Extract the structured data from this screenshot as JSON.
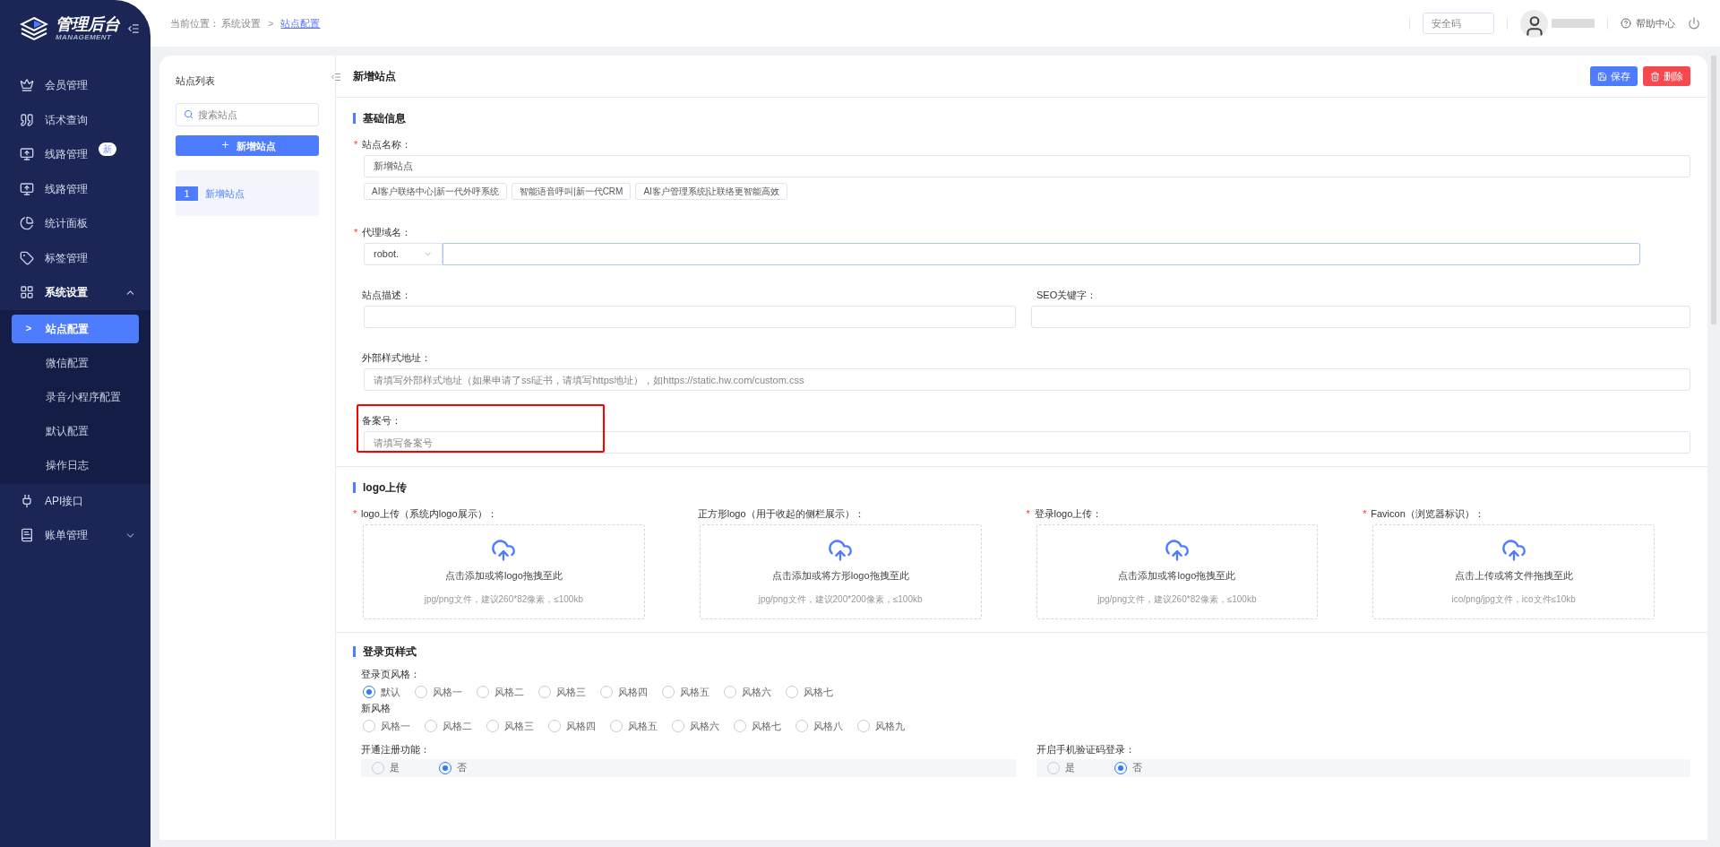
{
  "brand": {
    "title": "管理后台",
    "subtitle": "MANAGEMENT"
  },
  "sidebar": {
    "items": [
      {
        "kind": "link",
        "label": "会员管理",
        "selected": false
      },
      {
        "kind": "link",
        "label": "话术查询",
        "selected": false
      },
      {
        "kind": "link",
        "label": "线路管理",
        "badge": "新",
        "selected": false
      },
      {
        "kind": "link",
        "label": "线路管理",
        "selected": false
      },
      {
        "kind": "link",
        "label": "统计面板",
        "selected": false
      },
      {
        "kind": "link",
        "label": "标签管理",
        "selected": false
      },
      {
        "kind": "group",
        "label": "系统设置",
        "expanded": true,
        "selected": false,
        "children": [
          {
            "label": "站点配置",
            "marker": ">",
            "selected": true
          },
          {
            "label": "微信配置",
            "selected": false
          },
          {
            "label": "录音小程序配置",
            "selected": false
          },
          {
            "label": "默认配置",
            "selected": false
          },
          {
            "label": "操作日志",
            "selected": false
          }
        ]
      },
      {
        "kind": "link",
        "label": "API接口",
        "selected": false
      },
      {
        "kind": "group",
        "label": "账单管理",
        "expanded": false,
        "selected": false
      }
    ]
  },
  "breadcrumb": {
    "prefix": "当前位置：",
    "items": [
      "系统设置",
      "站点配置"
    ],
    "separator": ">"
  },
  "header": {
    "security_code": {
      "placeholder": "安全码"
    },
    "help": "帮助中心"
  },
  "site_list": {
    "title": "站点列表",
    "search": {
      "placeholder": "搜索站点"
    },
    "add_button": "新增站点",
    "items": [
      {
        "index": "1",
        "label": "新增站点",
        "selected": true
      }
    ]
  },
  "form": {
    "title": "新增站点",
    "required_mark": "*",
    "save": "保存",
    "delete": "删除",
    "basic": {
      "title": "基础信息",
      "name": {
        "label": "站点名称：",
        "required": true,
        "value": "新增站点",
        "suggestions": [
          "AI客户联络中心|新一代外呼系统",
          "智能语音呼叫|新一代CRM",
          "AI客户管理系统|让联络更智能高效"
        ]
      },
      "domain": {
        "label": "代理域名：",
        "required": true,
        "prefix": "robot."
      },
      "description": {
        "label": "站点描述：",
        "required": false
      },
      "seo": {
        "label": "SEO关键字：",
        "required": false
      },
      "style_url": {
        "label": "外部样式地址：",
        "required": false,
        "placeholder": "请填写外部样式地址（如果申请了ssl证书，请填写https地址），如https://static.hw.com/custom.css"
      },
      "icp": {
        "label": "备案号：",
        "required": false,
        "placeholder": "请填写备案号",
        "highlighted": true
      }
    },
    "logo": {
      "title": "logo上传",
      "uploads": [
        {
          "label": "logo上传（系统内logo展示）：",
          "required": true,
          "prompt": "点击添加或将logo拖拽至此",
          "hint": "jpg/png文件，建议260*82像素，≤100kb"
        },
        {
          "label": "正方形logo（用于收起的侧栏展示）：",
          "required": false,
          "prompt": "点击添加或将方形logo拖拽至此",
          "hint": "jpg/png文件，建议200*200像素，≤100kb"
        },
        {
          "label": "登录logo上传：",
          "required": true,
          "prompt": "点击添加或将logo拖拽至此",
          "hint": "jpg/png文件，建议260*82像素，≤100kb"
        },
        {
          "label": "Favicon（浏览器标识）：",
          "required": true,
          "prompt": "点击上传或将文件拖拽至此",
          "hint": "ico/png/jpg文件，ico文件≤10kb"
        }
      ]
    },
    "login": {
      "title": "登录页样式",
      "style_groups": [
        {
          "label": "登录页风格：",
          "options": [
            {
              "label": "默认",
              "selected": true
            },
            {
              "label": "风格一",
              "selected": false
            },
            {
              "label": "风格二",
              "selected": false
            },
            {
              "label": "风格三",
              "selected": false
            },
            {
              "label": "风格四",
              "selected": false
            },
            {
              "label": "风格五",
              "selected": false
            },
            {
              "label": "风格六",
              "selected": false
            },
            {
              "label": "风格七",
              "selected": false
            }
          ]
        },
        {
          "label": "新风格",
          "options": [
            {
              "label": "风格一",
              "selected": false
            },
            {
              "label": "风格二",
              "selected": false
            },
            {
              "label": "风格三",
              "selected": false
            },
            {
              "label": "风格四",
              "selected": false
            },
            {
              "label": "风格五",
              "selected": false
            },
            {
              "label": "风格六",
              "selected": false
            },
            {
              "label": "风格七",
              "selected": false
            },
            {
              "label": "风格八",
              "selected": false
            },
            {
              "label": "风格九",
              "selected": false
            }
          ]
        }
      ],
      "toggles": [
        {
          "label": "开通注册功能：",
          "options": [
            {
              "label": "是",
              "selected": false
            },
            {
              "label": "否",
              "selected": true
            }
          ]
        },
        {
          "label": "开启手机验证码登录：",
          "options": [
            {
              "label": "是",
              "selected": false
            },
            {
              "label": "否",
              "selected": true
            }
          ]
        }
      ]
    }
  }
}
